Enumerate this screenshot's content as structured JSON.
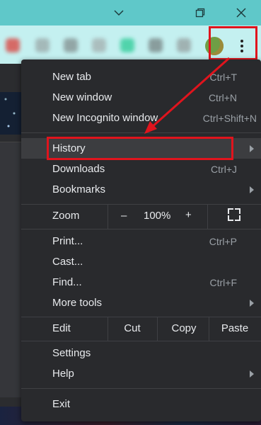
{
  "window": {
    "icons": [
      "chevron-down-icon",
      "restore-icon",
      "close-icon"
    ],
    "accent": "#5fc8c9"
  },
  "menu": {
    "items_top": [
      {
        "label": "New tab",
        "shortcut": "Ctrl+T"
      },
      {
        "label": "New window",
        "shortcut": "Ctrl+N"
      },
      {
        "label": "New Incognito window",
        "shortcut": "Ctrl+Shift+N"
      }
    ],
    "items_history": [
      {
        "label": "History",
        "shortcut": "",
        "submenu": true
      },
      {
        "label": "Downloads",
        "shortcut": "Ctrl+J"
      },
      {
        "label": "Bookmarks",
        "shortcut": "",
        "submenu": true
      }
    ],
    "zoom": {
      "label": "Zoom",
      "minus": "–",
      "value": "100%",
      "plus": "+"
    },
    "items_tools": [
      {
        "label": "Print...",
        "shortcut": "Ctrl+P"
      },
      {
        "label": "Cast...",
        "shortcut": ""
      },
      {
        "label": "Find...",
        "shortcut": "Ctrl+F"
      },
      {
        "label": "More tools",
        "shortcut": "",
        "submenu": true
      }
    ],
    "edit": {
      "label": "Edit",
      "cut": "Cut",
      "copy": "Copy",
      "paste": "Paste"
    },
    "items_settings": [
      {
        "label": "Settings",
        "shortcut": ""
      },
      {
        "label": "Help",
        "shortcut": "",
        "submenu": true
      }
    ],
    "exit": {
      "label": "Exit"
    },
    "highlight_color": "#e0141d"
  }
}
